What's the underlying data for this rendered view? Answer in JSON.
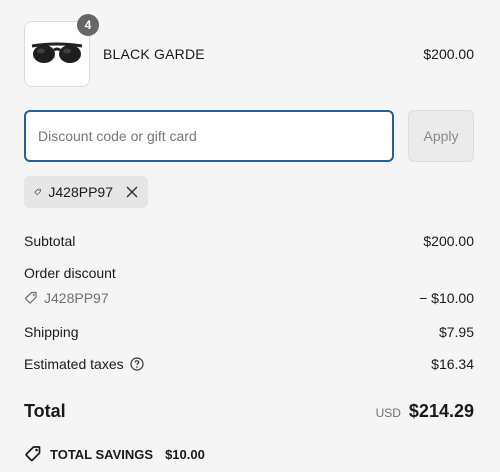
{
  "product": {
    "name": "BLACK GARDE",
    "price": "$200.00",
    "quantity": "4",
    "image_icon": "sunglasses"
  },
  "discount": {
    "placeholder": "Discount code or gift card",
    "value": "",
    "apply_label": "Apply",
    "applied_code": "J428PP97"
  },
  "summary": {
    "subtotal_label": "Subtotal",
    "subtotal_value": "$200.00",
    "order_discount_label": "Order discount",
    "discount_code": "J428PP97",
    "discount_value": "− $10.00",
    "shipping_label": "Shipping",
    "shipping_value": "$7.95",
    "taxes_label": "Estimated taxes",
    "taxes_value": "$16.34",
    "total_label": "Total",
    "currency": "USD",
    "total_value": "$214.29",
    "savings_label": "TOTAL SAVINGS",
    "savings_value": "$10.00"
  },
  "colors": {
    "input_border": "#1f5fa3",
    "background": "#f5f5f5"
  }
}
